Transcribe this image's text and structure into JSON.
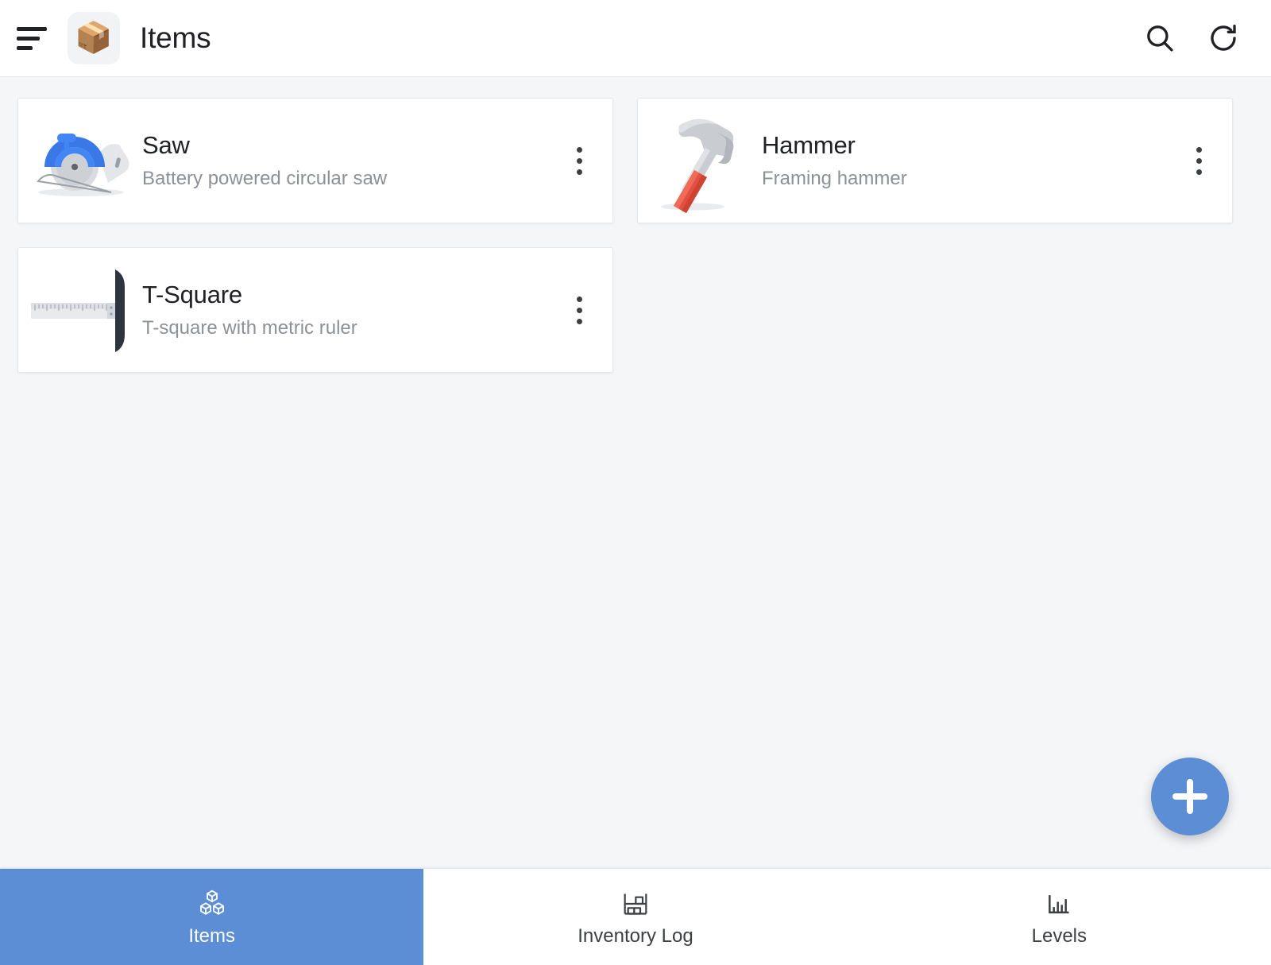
{
  "header": {
    "menu_icon": "sort-menu-icon",
    "app_icon": "package-box-icon",
    "app_icon_glyph": "📦",
    "title": "Items",
    "actions": [
      {
        "name": "search-button",
        "icon": "search-icon"
      },
      {
        "name": "refresh-button",
        "icon": "refresh-icon"
      }
    ]
  },
  "items": [
    {
      "title": "Saw",
      "subtitle": "Battery powered circular saw",
      "thumb": "circular-saw-image",
      "menu_icon": "more-vertical-icon"
    },
    {
      "title": "Hammer",
      "subtitle": "Framing hammer",
      "thumb": "hammer-image",
      "menu_icon": "more-vertical-icon"
    },
    {
      "title": "T-Square",
      "subtitle": "T-square with metric ruler",
      "thumb": "t-square-image",
      "menu_icon": "more-vertical-icon"
    }
  ],
  "fab": {
    "name": "add-item-button",
    "icon": "plus-icon",
    "label": "+"
  },
  "bottom_nav": {
    "active_index": 0,
    "items": [
      {
        "label": "Items",
        "icon": "cubes-icon",
        "active": true
      },
      {
        "label": "Inventory Log",
        "icon": "shelf-rack-icon",
        "active": false
      },
      {
        "label": "Levels",
        "icon": "bar-chart-icon",
        "active": false
      }
    ]
  },
  "colors": {
    "accent": "#5b8ed4",
    "page_background": "#f4f6f8",
    "card_background": "#ffffff",
    "title_text": "#202124",
    "subtitle_text": "#8d9196",
    "saw_blue": "#4285f4",
    "hammer_red": "#e2503f",
    "hammer_gray": "#b9bdc2",
    "tsquare_dark": "#2f3540"
  }
}
